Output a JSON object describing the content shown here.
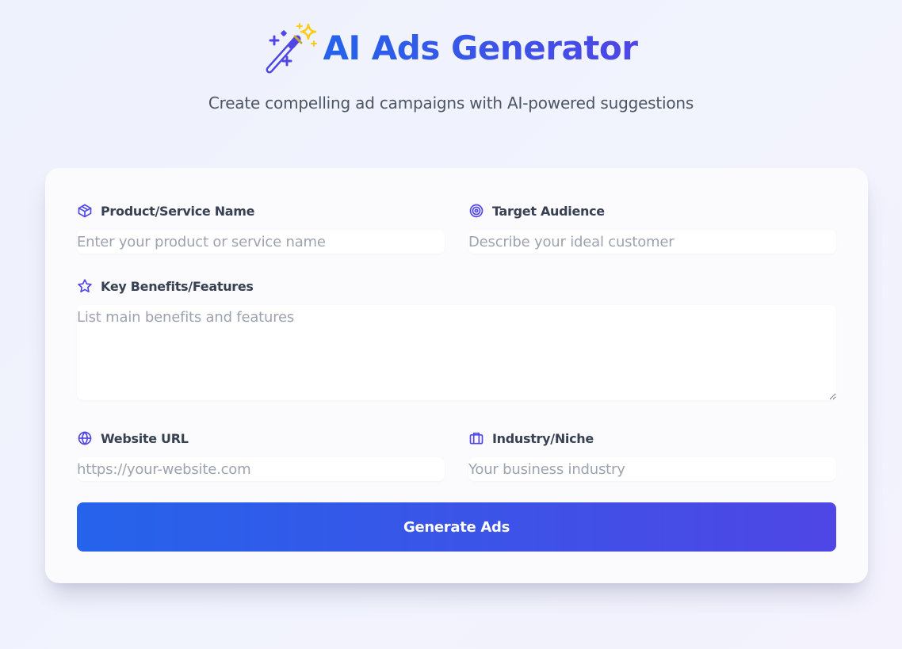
{
  "header": {
    "title": "AI Ads Generator",
    "subtitle": "Create compelling ad campaigns with AI-powered suggestions",
    "icon": "magic-wand-icon"
  },
  "form": {
    "product_name": {
      "label": "Product/Service Name",
      "icon": "cube-icon",
      "value": "",
      "placeholder": "Enter your product or service name"
    },
    "target_audience": {
      "label": "Target Audience",
      "icon": "target-icon",
      "value": "",
      "placeholder": "Describe your ideal customer"
    },
    "key_benefits": {
      "label": "Key Benefits/Features",
      "icon": "star-icon",
      "value": "",
      "placeholder": "List main benefits and features"
    },
    "website_url": {
      "label": "Website URL",
      "icon": "globe-icon",
      "value": "",
      "placeholder": "https://your-website.com"
    },
    "industry": {
      "label": "Industry/Niche",
      "icon": "briefcase-icon",
      "value": "",
      "placeholder": "Your business industry"
    },
    "submit_label": "Generate Ads"
  },
  "colors": {
    "accent_start": "#2563eb",
    "accent_end": "#4f46e5",
    "icon_color": "#4f46e5",
    "sparkle_color": "#facc15"
  }
}
